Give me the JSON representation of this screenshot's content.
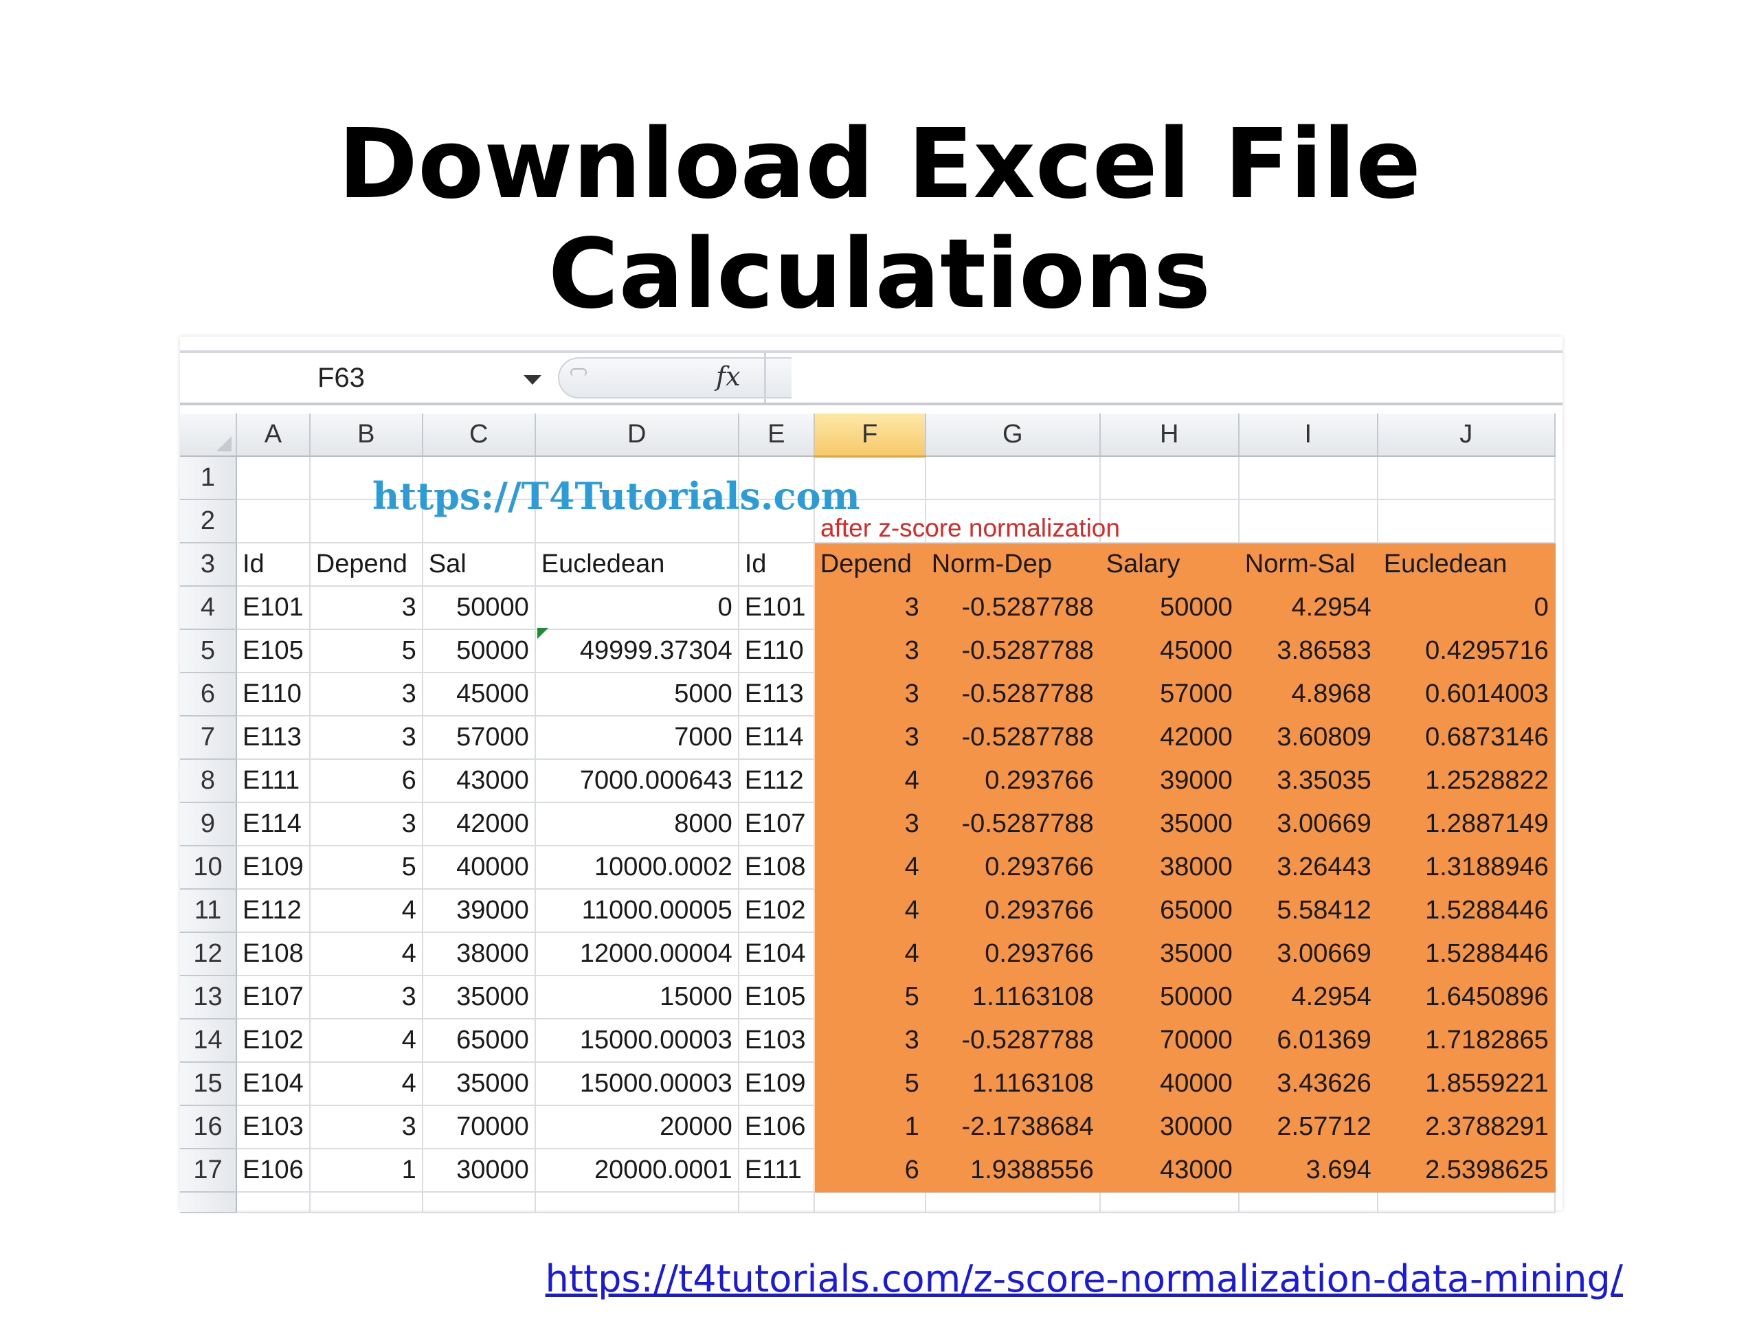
{
  "slide": {
    "title": "Download Excel File Calculations",
    "source_link": "https://t4tutorials.com/z-score-normalization-data-mining/"
  },
  "spreadsheet": {
    "name_box": "F63",
    "fx_symbol": "fx",
    "overlay_url": "https://T4Tutorials.com",
    "note": "after z-score normalization",
    "highlight_color": "#f39449",
    "active_column": "F",
    "columns": [
      "A",
      "B",
      "C",
      "D",
      "E",
      "F",
      "G",
      "H",
      "I",
      "J"
    ],
    "row_numbers": [
      "1",
      "2",
      "3",
      "4",
      "5",
      "6",
      "7",
      "8",
      "9",
      "10",
      "11",
      "12",
      "13",
      "14",
      "15",
      "16",
      "17"
    ],
    "headers": [
      "Id",
      "Depend",
      "Sal",
      "Eucledean",
      "Id",
      "Depend",
      "Norm-Dep",
      "Salary",
      "Norm-Sal",
      "Eucledean"
    ],
    "rows": [
      [
        "E101",
        "3",
        "50000",
        "0",
        "E101",
        "3",
        "-0.5287788",
        "50000",
        "4.2954",
        "0"
      ],
      [
        "E105",
        "5",
        "50000",
        "49999.37304",
        "E110",
        "3",
        "-0.5287788",
        "45000",
        "3.86583",
        "0.4295716"
      ],
      [
        "E110",
        "3",
        "45000",
        "5000",
        "E113",
        "3",
        "-0.5287788",
        "57000",
        "4.8968",
        "0.6014003"
      ],
      [
        "E113",
        "3",
        "57000",
        "7000",
        "E114",
        "3",
        "-0.5287788",
        "42000",
        "3.60809",
        "0.6873146"
      ],
      [
        "E111",
        "6",
        "43000",
        "7000.000643",
        "E112",
        "4",
        "0.293766",
        "39000",
        "3.35035",
        "1.2528822"
      ],
      [
        "E114",
        "3",
        "42000",
        "8000",
        "E107",
        "3",
        "-0.5287788",
        "35000",
        "3.00669",
        "1.2887149"
      ],
      [
        "E109",
        "5",
        "40000",
        "10000.0002",
        "E108",
        "4",
        "0.293766",
        "38000",
        "3.26443",
        "1.3188946"
      ],
      [
        "E112",
        "4",
        "39000",
        "11000.00005",
        "E102",
        "4",
        "0.293766",
        "65000",
        "5.58412",
        "1.5288446"
      ],
      [
        "E108",
        "4",
        "38000",
        "12000.00004",
        "E104",
        "4",
        "0.293766",
        "35000",
        "3.00669",
        "1.5288446"
      ],
      [
        "E107",
        "3",
        "35000",
        "15000",
        "E105",
        "5",
        "1.1163108",
        "50000",
        "4.2954",
        "1.6450896"
      ],
      [
        "E102",
        "4",
        "65000",
        "15000.00003",
        "E103",
        "3",
        "-0.5287788",
        "70000",
        "6.01369",
        "1.7182865"
      ],
      [
        "E104",
        "4",
        "35000",
        "15000.00003",
        "E109",
        "5",
        "1.1163108",
        "40000",
        "3.43626",
        "1.8559221"
      ],
      [
        "E103",
        "3",
        "70000",
        "20000",
        "E106",
        "1",
        "-2.1738684",
        "30000",
        "2.57712",
        "2.3788291"
      ],
      [
        "E106",
        "1",
        "30000",
        "20000.0001",
        "E111",
        "6",
        "1.9388556",
        "43000",
        "3.694",
        "2.5398625"
      ]
    ]
  }
}
